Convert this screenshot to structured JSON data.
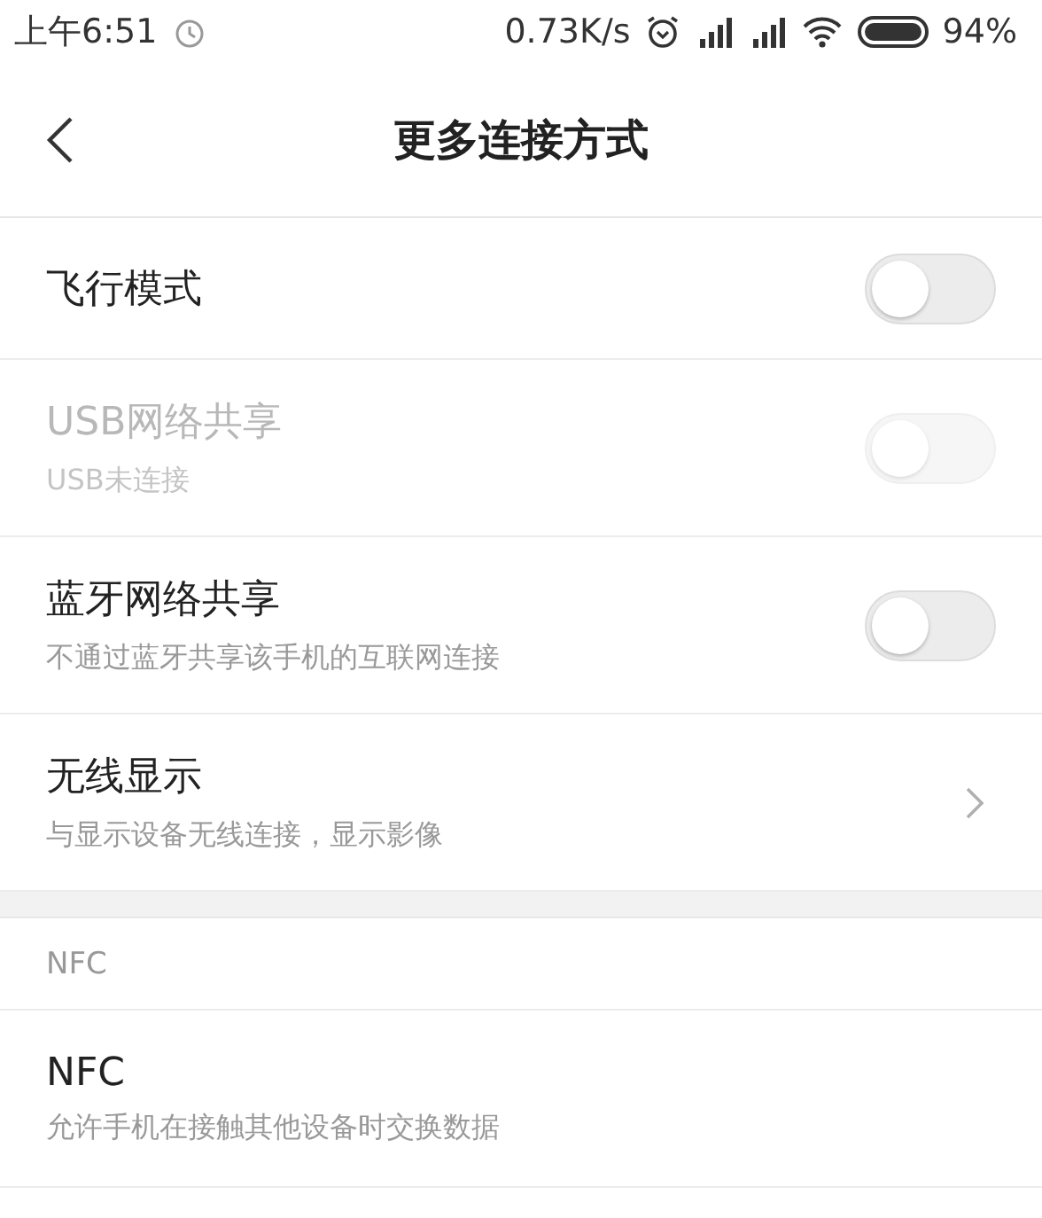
{
  "status_bar": {
    "time": "上午6:51",
    "speed": "0.73K/s",
    "battery": "94%"
  },
  "header": {
    "title": "更多连接方式"
  },
  "sections": [
    {
      "items": [
        {
          "kind": "toggle",
          "title": "飞行模式",
          "on": false,
          "disabled": false
        },
        {
          "kind": "toggle",
          "title": "USB网络共享",
          "subtitle": "USB未连接",
          "on": false,
          "disabled": true
        },
        {
          "kind": "toggle",
          "title": "蓝牙网络共享",
          "subtitle": "不通过蓝牙共享该手机的互联网连接",
          "on": false,
          "disabled": false
        },
        {
          "kind": "link",
          "title": "无线显示",
          "subtitle": "与显示设备无线连接，显示影像",
          "disabled": false
        }
      ]
    },
    {
      "heading": "NFC",
      "items": [
        {
          "kind": "plain",
          "title": "NFC",
          "subtitle": "允许手机在接触其他设备时交换数据",
          "disabled": false
        }
      ]
    }
  ]
}
